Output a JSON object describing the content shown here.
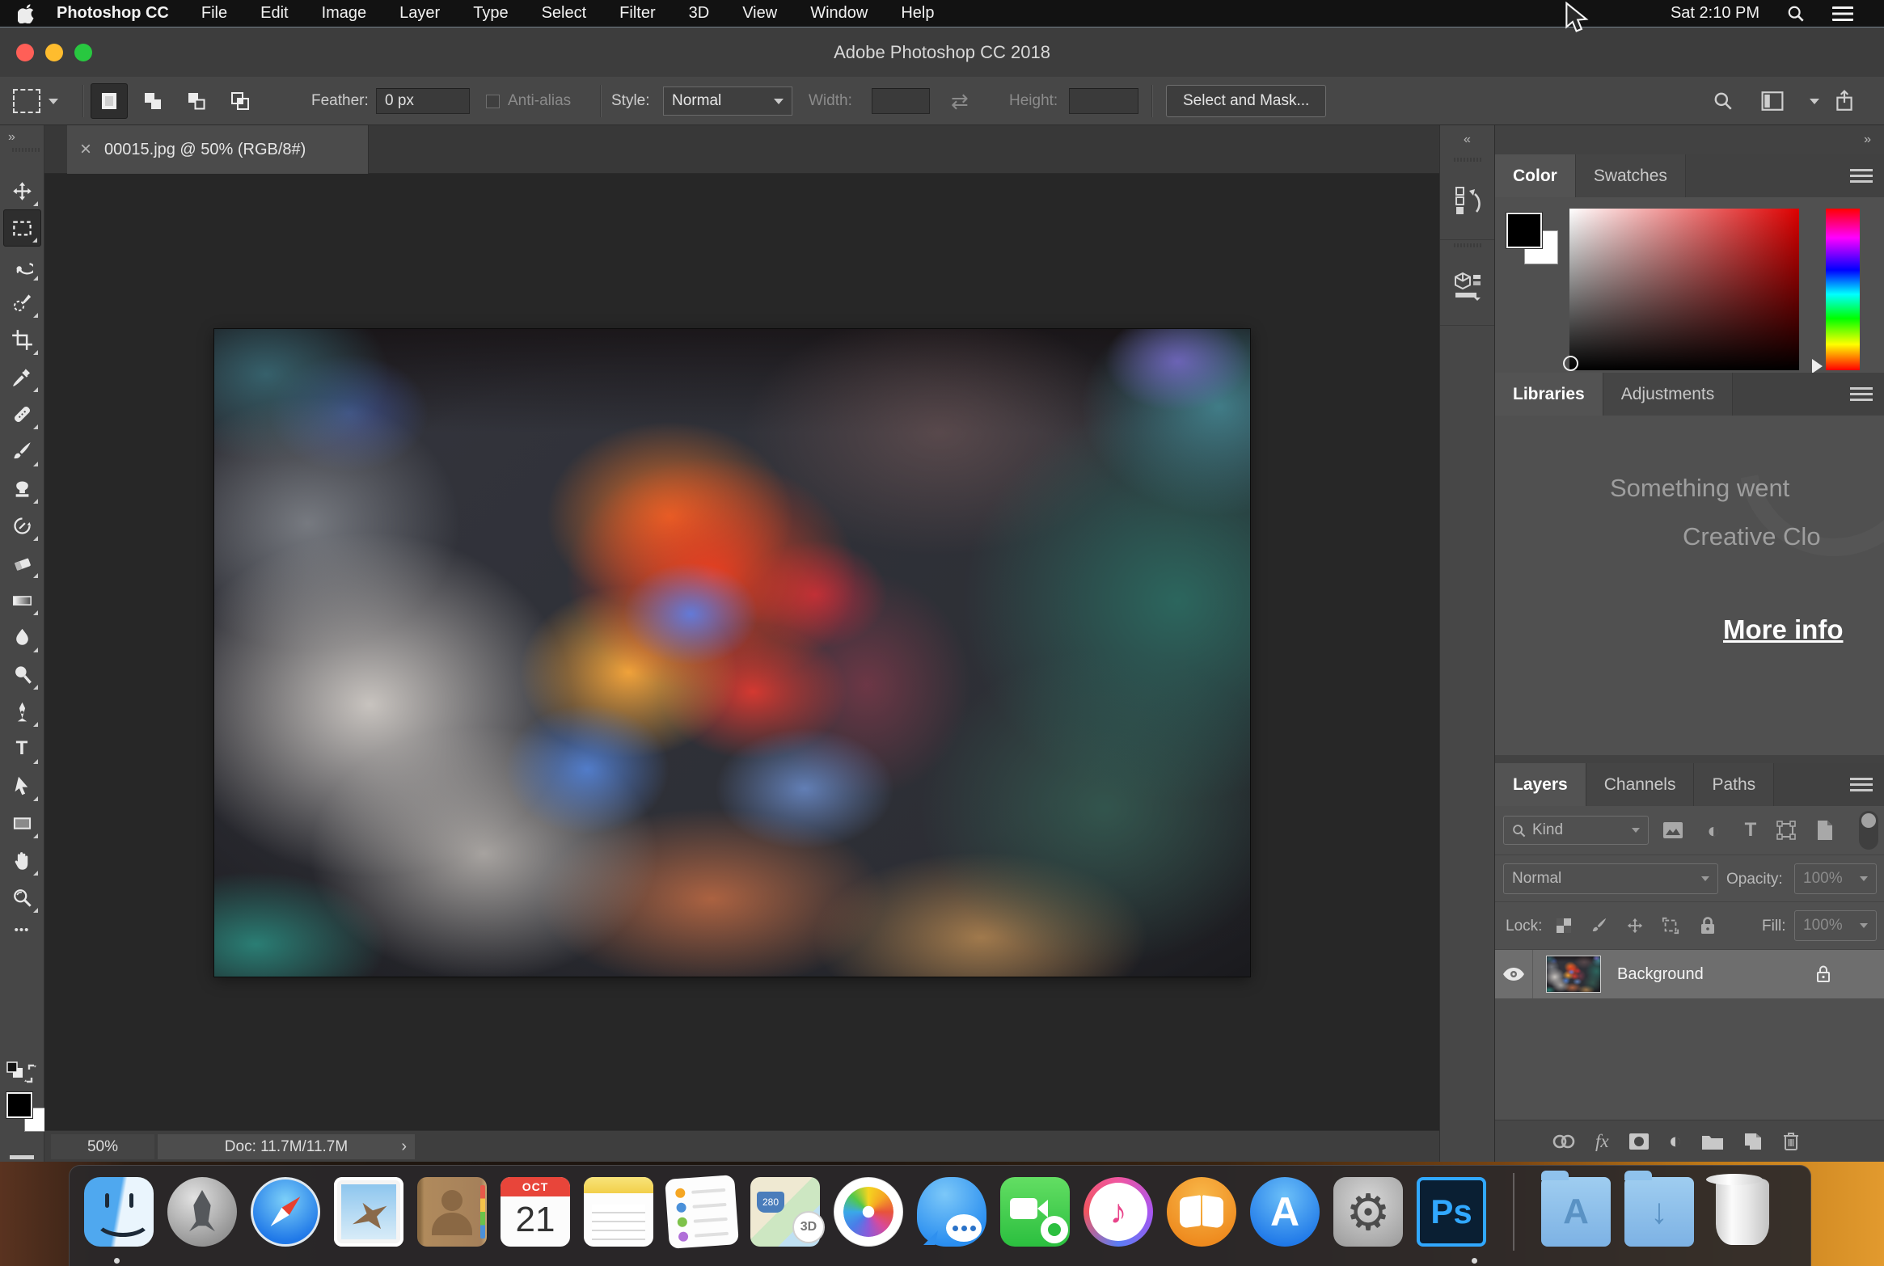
{
  "menu_bar": {
    "app_name": "Photoshop CC",
    "items": [
      "File",
      "Edit",
      "Image",
      "Layer",
      "Type",
      "Select",
      "Filter",
      "3D",
      "View",
      "Window",
      "Help"
    ],
    "clock": "Sat 2:10 PM"
  },
  "title_bar": {
    "title": "Adobe Photoshop CC 2018"
  },
  "options_bar": {
    "feather_label": "Feather:",
    "feather_value": "0 px",
    "anti_alias_label": "Anti-alias",
    "style_label": "Style:",
    "style_value": "Normal",
    "width_label": "Width:",
    "width_value": "",
    "height_label": "Height:",
    "height_value": "",
    "select_and_mask_label": "Select and Mask..."
  },
  "document": {
    "tab_title": "00015.jpg @ 50% (RGB/8#)",
    "zoom_level": "50%",
    "doc_size": "Doc: 11.7M/11.7M"
  },
  "toolbar": {
    "tools": [
      "move",
      "rectangular-marquee",
      "lasso",
      "quick-selection",
      "crop",
      "eyedropper",
      "spot-healing",
      "brush",
      "clone-stamp",
      "history-brush",
      "eraser",
      "gradient",
      "blur",
      "dodge",
      "pen",
      "type",
      "path-selection",
      "rectangle-shape",
      "hand",
      "zoom",
      "ellipsis"
    ],
    "selected_tool": "rectangular-marquee"
  },
  "color_panel": {
    "tab_color": "Color",
    "tab_swatches": "Swatches"
  },
  "libraries_panel": {
    "tab_libraries": "Libraries",
    "tab_adjustments": "Adjustments",
    "message_line1": "Something went",
    "message_line2": "Creative Clo",
    "more_info_link": "More info"
  },
  "layers_panel": {
    "tab_layers": "Layers",
    "tab_channels": "Channels",
    "tab_paths": "Paths",
    "filter_value": "Kind",
    "blend_mode": "Normal",
    "opacity_label": "Opacity:",
    "opacity_value": "100%",
    "lock_label": "Lock:",
    "fill_label": "Fill:",
    "fill_value": "100%",
    "fx_label": "fx",
    "layers": [
      {
        "name": "Background",
        "visible": true,
        "locked": true
      }
    ]
  },
  "dock": {
    "items": [
      "finder",
      "launchpad",
      "safari",
      "mail",
      "contacts",
      "calendar",
      "notes",
      "reminders",
      "maps",
      "photos",
      "messages",
      "facetime",
      "itunes",
      "ibooks",
      "app-store",
      "system-preferences",
      "photoshop",
      "applications-folder",
      "downloads-folder",
      "trash"
    ],
    "calendar_month": "OCT",
    "calendar_day": "21",
    "maps_badge": "3D",
    "maps_shield": "280",
    "photoshop_label": "Ps",
    "app_store_letter": "A",
    "applications_letter": "A"
  },
  "icons_glyphs": {
    "close": "×",
    "collapse_left": "«",
    "collapse_right": "»",
    "chevron": "›",
    "ellipsis": "•••",
    "swap_arrows": "⇄",
    "adjustment_circle": "◐",
    "gear": "⚙",
    "music_note": "♪",
    "down_arrow": "↓",
    "type_t": "T"
  },
  "colors": {
    "ps_accent_blue": "#31a8ff",
    "traffic_red": "#ff5f57",
    "traffic_yellow": "#febc2e",
    "traffic_green": "#28c840",
    "menubar_bg": "#121212",
    "panel_bg": "#4a4a4a",
    "canvas_bg": "#272727",
    "selected_layer_bg": "#6e6e6e"
  }
}
